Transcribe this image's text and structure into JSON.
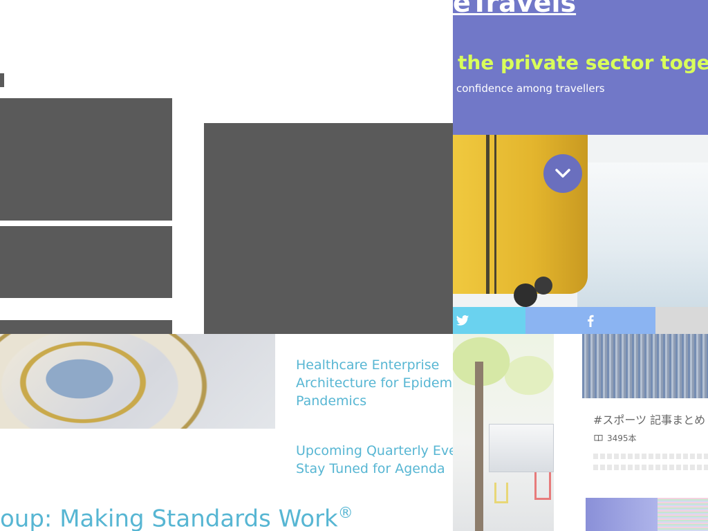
{
  "hero": {
    "title": "eTravels",
    "tagline": "the private sector togethe",
    "subtitle": "confidence among travellers"
  },
  "articles": [
    {
      "title_line1": "Healthcare Enterprise",
      "title_line2": "Architecture for Epidemi",
      "title_line3": "Pandemics"
    },
    {
      "title_line1": "Upcoming Quarterly Eve",
      "title_line2": "Stay Tuned for Agenda"
    }
  ],
  "section": {
    "heading": "oup: Making Standards Work",
    "heading_mark": "®"
  },
  "tag_card": {
    "title": "#スポーツ 記事まとめ",
    "count": "3495本"
  },
  "colors": {
    "hero_bg": "#7178c8",
    "tagline": "#d9ff5a",
    "link": "#57b6d3",
    "twitter": "#6ad2ef",
    "facebook": "#8bb4f2"
  }
}
